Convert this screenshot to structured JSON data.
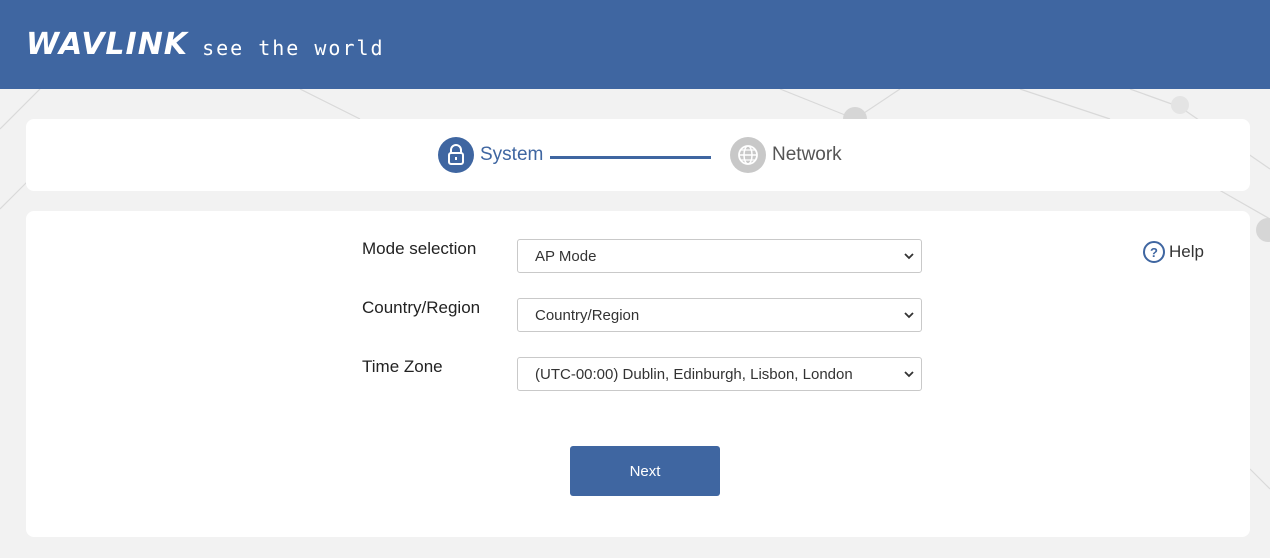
{
  "header": {
    "logo_text": "WAVLINK",
    "slogan": "see the world",
    "background_color": "#3f66a1"
  },
  "steps": [
    {
      "label": "System",
      "icon": "lock-icon",
      "active": true
    },
    {
      "label": "Network",
      "icon": "globe-icon",
      "active": false
    }
  ],
  "form": {
    "fields": [
      {
        "label": "Mode selection",
        "value": "AP Mode"
      },
      {
        "label": "Country/Region",
        "value": "Country/Region"
      },
      {
        "label": "Time Zone",
        "value": "(UTC-00:00) Dublin, Edinburgh, Lisbon, London"
      }
    ],
    "help_label": "Help",
    "help_glyph": "?",
    "next_label": "Next"
  },
  "colors": {
    "accent": "#3f66a1",
    "inactive": "#c8c8c8",
    "page_bg": "#f2f2f2"
  }
}
